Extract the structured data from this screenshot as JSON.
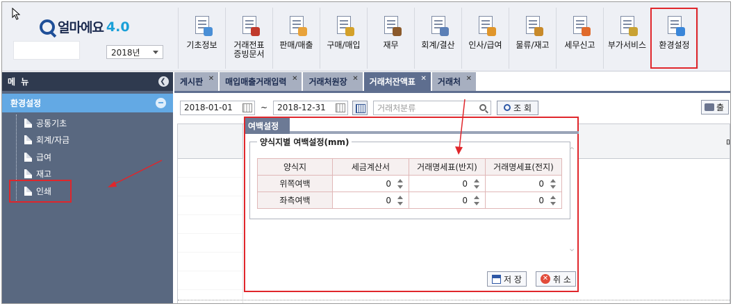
{
  "header": {
    "logo_text": "얼마에요",
    "logo_version": "4.0",
    "year": "2018년"
  },
  "menu": [
    {
      "label": "기초정보",
      "icon": "basic-info-icon",
      "accent": "#4a8fd6"
    },
    {
      "label": "거래전표\n증빙문서",
      "icon": "voucher-icon",
      "accent": "#c0392b"
    },
    {
      "label": "판매/매출",
      "icon": "sales-icon",
      "accent": "#e8a23a"
    },
    {
      "label": "구매/매입",
      "icon": "purchase-icon",
      "accent": "#d4a12a"
    },
    {
      "label": "재무",
      "icon": "finance-bag-icon",
      "accent": "#8b5a2b"
    },
    {
      "label": "회계/결산",
      "icon": "accounting-icon",
      "accent": "#5b7fb6"
    },
    {
      "label": "인사/급여",
      "icon": "hr-icon",
      "accent": "#e0962b"
    },
    {
      "label": "물류/재고",
      "icon": "logistics-icon",
      "accent": "#c88a2a"
    },
    {
      "label": "세무신고",
      "icon": "tax-icon",
      "accent": "#e06a2b"
    },
    {
      "label": "부가서비스",
      "icon": "bank-icon",
      "accent": "#c9a233"
    },
    {
      "label": "환경설정",
      "icon": "settings-gear-icon",
      "accent": "#3a86d9"
    }
  ],
  "sidebar": {
    "title": "메 뉴",
    "section": "환경설정",
    "items": [
      "공통기초",
      "회계/자금",
      "급여",
      "재고",
      "인쇄"
    ]
  },
  "tabs": [
    {
      "label": "게시판",
      "active": false
    },
    {
      "label": "매입매출거래입력",
      "active": false
    },
    {
      "label": "거래처원장",
      "active": false
    },
    {
      "label": "거래처잔액표",
      "active": true
    },
    {
      "label": "거래처",
      "active": false
    }
  ],
  "filter": {
    "date_from": "2018-01-01",
    "tilde": "~",
    "date_to": "2018-12-31",
    "category_placeholder": "거래처분류",
    "query_label": "조 회",
    "print_label": "출"
  },
  "grid": {
    "right_header_partial": "매"
  },
  "dialog": {
    "tab_label": "여백설정",
    "group_title": "양식지별 여백설정(mm)",
    "columns": [
      "양식지",
      "세금계산서",
      "거래명세표(반지)",
      "거래명세표(전지)"
    ],
    "rows": [
      {
        "label": "위쪽여백",
        "values": [
          "0",
          "0",
          "0"
        ]
      },
      {
        "label": "좌측여백",
        "values": [
          "0",
          "0",
          "0"
        ]
      }
    ],
    "save_label": "저 장",
    "cancel_label": "취 소"
  },
  "colors": {
    "highlight": "#e0262b",
    "sidebar_bg": "#596880",
    "section_bg": "#63a9e4",
    "active_tab": "#5e6e8f"
  }
}
